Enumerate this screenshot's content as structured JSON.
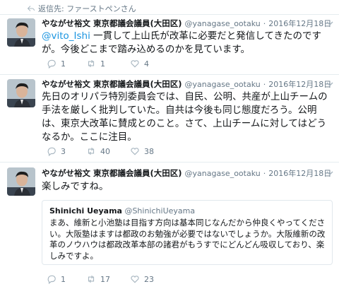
{
  "reply_context": {
    "text": "返信先: ファーストペンさん"
  },
  "tweets": [
    {
      "name": "やながせ裕文 東京都議会議員(大田区)",
      "handle": "@yanagase_ootaku",
      "dot": "·",
      "date": "2016年12月18日",
      "mention": "@vito_Ishi",
      "body": " 一貫して上山氏が改革に必要だと発信してきたのですが。今後どこまで踏み込めるのかを見ています。",
      "replies": "1",
      "retweets": "1",
      "likes": "4"
    },
    {
      "name": "やながせ裕文 東京都議会議員(大田区)",
      "handle": "@yanagase_ootaku",
      "dot": "·",
      "date": "2016年12月18日",
      "body": "先日のオリパラ特別委員会では、自民、公明、共産が上山チームの手法を厳しく批判していた。自共は今後も同じ態度だろう。公明は、東京大改革に賛成とのこと。さて、上山チームに対してはどうなるか。ここに注目。",
      "replies": "3",
      "retweets": "40",
      "likes": "38"
    },
    {
      "name": "やながせ裕文 東京都議会議員(大田区)",
      "handle": "@yanagase_ootaku",
      "dot": "·",
      "date": "2016年12月18日",
      "body": "楽しみですね。",
      "quote": {
        "name": "Shinichi Ueyama",
        "handle": "@ShinichiUeyama",
        "body": "まあ、維新と小池塾は目指す方向は基本同じなんだから仲良くやってください。大阪塾はますは都政のお勉強が必要ではないでしょうか。大阪維新の改革のノウハウは都政改革本部の諸君がもうすでにどんどん吸収しており、楽しみですよ。"
      },
      "replies": "1",
      "retweets": "17",
      "likes": "23"
    }
  ],
  "icons": {
    "reply": "reply-icon",
    "retweet": "retweet-icon",
    "like": "heart-icon",
    "caret": "chevron-down-icon",
    "reply_context": "reply-arrow-icon"
  },
  "colors": {
    "link": "#1b95e0",
    "secondary_text": "#657786",
    "divider": "#e6ecf0"
  }
}
